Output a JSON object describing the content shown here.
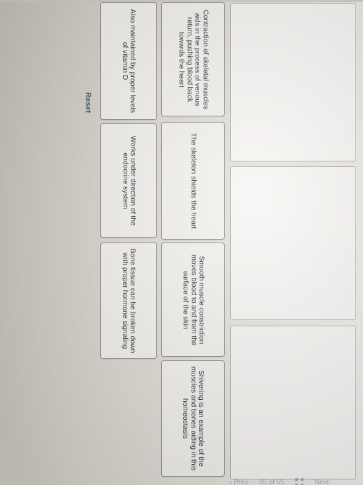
{
  "cards": [
    {
      "text": "Contraction of skeletal muscles aids in the process of venous return, pushing blood back towards the heart"
    },
    {
      "text": "Also maintained by proper levels of vitamin D"
    },
    {
      "text": "The skeleton shields the heart"
    },
    {
      "text": "Works under direction of the endocrine system"
    },
    {
      "text": "Smooth muscle constriction moves blood to and from the surface of the skin"
    },
    {
      "text": "Bone tissue can be broken down with proper hormone signaling"
    },
    {
      "text": "Shivering is an example of the muscles and bones aiding in this homeostasis"
    }
  ],
  "reset_label": "Reset",
  "footer": {
    "prev_label": "Prev",
    "page_count": "65 of 65",
    "next_label": "Next"
  }
}
